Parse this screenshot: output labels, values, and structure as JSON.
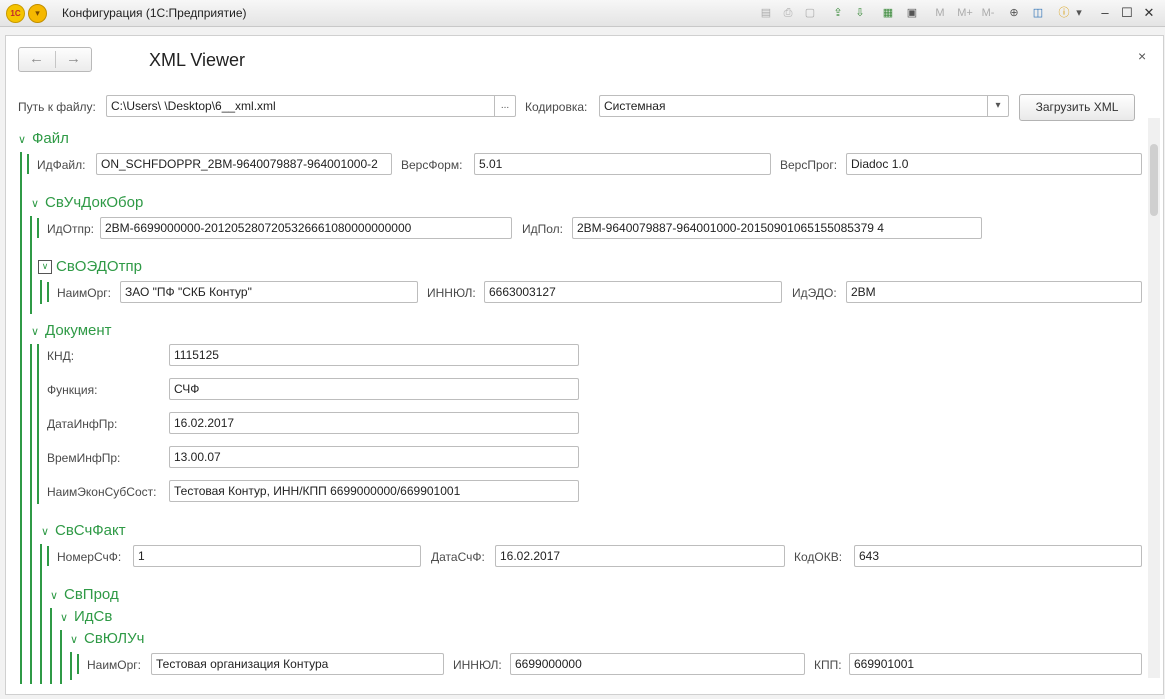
{
  "window": {
    "title": "Конфигурация  (1С:Предприятие)",
    "toolbar_extra": [
      "M",
      "M+",
      "M-"
    ]
  },
  "form": {
    "title": "XML Viewer",
    "back_glyph": "←",
    "forward_glyph": "→",
    "close_glyph": "×"
  },
  "file": {
    "path_label": "Путь к файлу:",
    "path_value": "C:\\Users\\          \\Desktop\\6__xml.xml",
    "path_button": "...",
    "encoding_label": "Кодировка:",
    "encoding_value": "Системная",
    "load_button": "Загрузить XML"
  },
  "tree": {
    "fayl": {
      "title": "Файл",
      "fields": [
        {
          "label": "ИдФайл:",
          "value": "ON_SCHFDOPPR_2BM-9640079887-964001000-2"
        },
        {
          "label": "ВерсФорм:",
          "value": "5.01"
        },
        {
          "label": "ВерсПрог:",
          "value": "Diadoc 1.0"
        }
      ]
    },
    "svuch": {
      "title": "СвУчДокОбор",
      "fields": [
        {
          "label": "ИдОтпр:",
          "value": "2BM-6699000000-2012052807205326661080000000000"
        },
        {
          "label": "ИдПол:",
          "value": "2BM-9640079887-964001000-20150901065155085379 4"
        }
      ]
    },
    "svoedo": {
      "title": "СвОЭДОтпр",
      "fields": [
        {
          "label": "НаимОрг:",
          "value": "ЗАО \"ПФ \"СКБ Контур\""
        },
        {
          "label": "ИННЮЛ:",
          "value": "6663003127"
        },
        {
          "label": "ИдЭДО:",
          "value": "2BM"
        }
      ]
    },
    "dokument": {
      "title": "Документ",
      "fields": [
        {
          "label": "КНД:",
          "value": "1115125"
        },
        {
          "label": "Функция:",
          "value": "СЧФ"
        },
        {
          "label": "ДатаИнфПр:",
          "value": "16.02.2017"
        },
        {
          "label": "ВремИнфПр:",
          "value": "13.00.07"
        },
        {
          "label": "НаимЭконСубСост:",
          "value": "Тестовая Контур, ИНН/КПП 6699000000/669901001"
        }
      ]
    },
    "svschfakt": {
      "title": "СвСчФакт",
      "fields": [
        {
          "label": "НомерСчФ:",
          "value": "1"
        },
        {
          "label": "ДатаСчФ:",
          "value": "16.02.2017"
        },
        {
          "label": "КодОКВ:",
          "value": "643"
        }
      ]
    },
    "svprod": {
      "title": "СвПрод"
    },
    "idsv": {
      "title": "ИдСв"
    },
    "svyulu": {
      "title": "СвЮЛУч",
      "fields": [
        {
          "label": "НаимОрг:",
          "value": "Тестовая организация Контура"
        },
        {
          "label": "ИННЮЛ:",
          "value": "6699000000"
        },
        {
          "label": "КПП:",
          "value": "669901001"
        }
      ]
    }
  }
}
